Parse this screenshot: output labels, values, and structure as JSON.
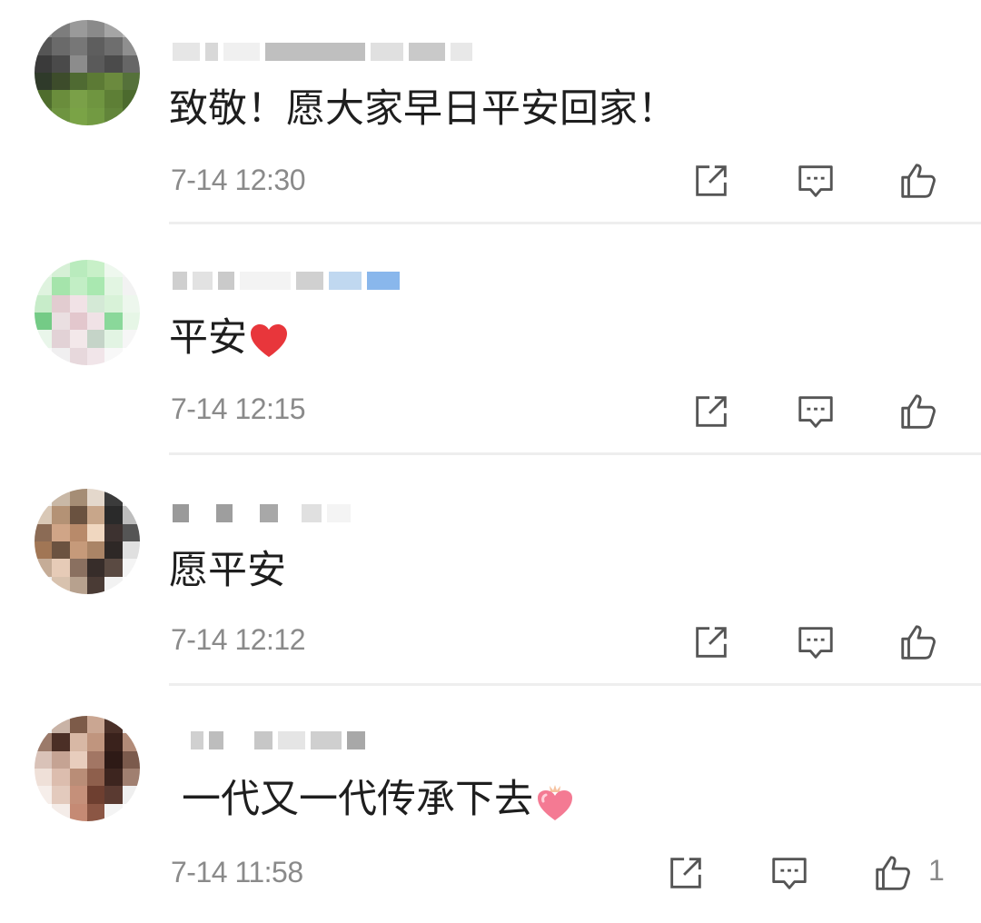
{
  "comments": [
    {
      "text": "致敬！愿大家早日平安回家！",
      "time": "7-14 12:30",
      "like_count": "",
      "emoji": ""
    },
    {
      "text": "平安",
      "time": "7-14 12:15",
      "like_count": "",
      "emoji": "red-heart"
    },
    {
      "text": "愿平安",
      "time": "7-14 12:12",
      "like_count": "",
      "emoji": ""
    },
    {
      "text": "一代又一代传承下去",
      "time": "7-14 11:58",
      "like_count": "1",
      "emoji": "pink-heart-with-crown"
    }
  ],
  "icons": {
    "share": "share-icon",
    "comment": "comment-icon",
    "like": "thumbs-up-icon"
  },
  "colors": {
    "text": "#1e1e1e",
    "meta": "#8a8a8a",
    "divider": "#eeeeee",
    "icon": "#555555"
  }
}
